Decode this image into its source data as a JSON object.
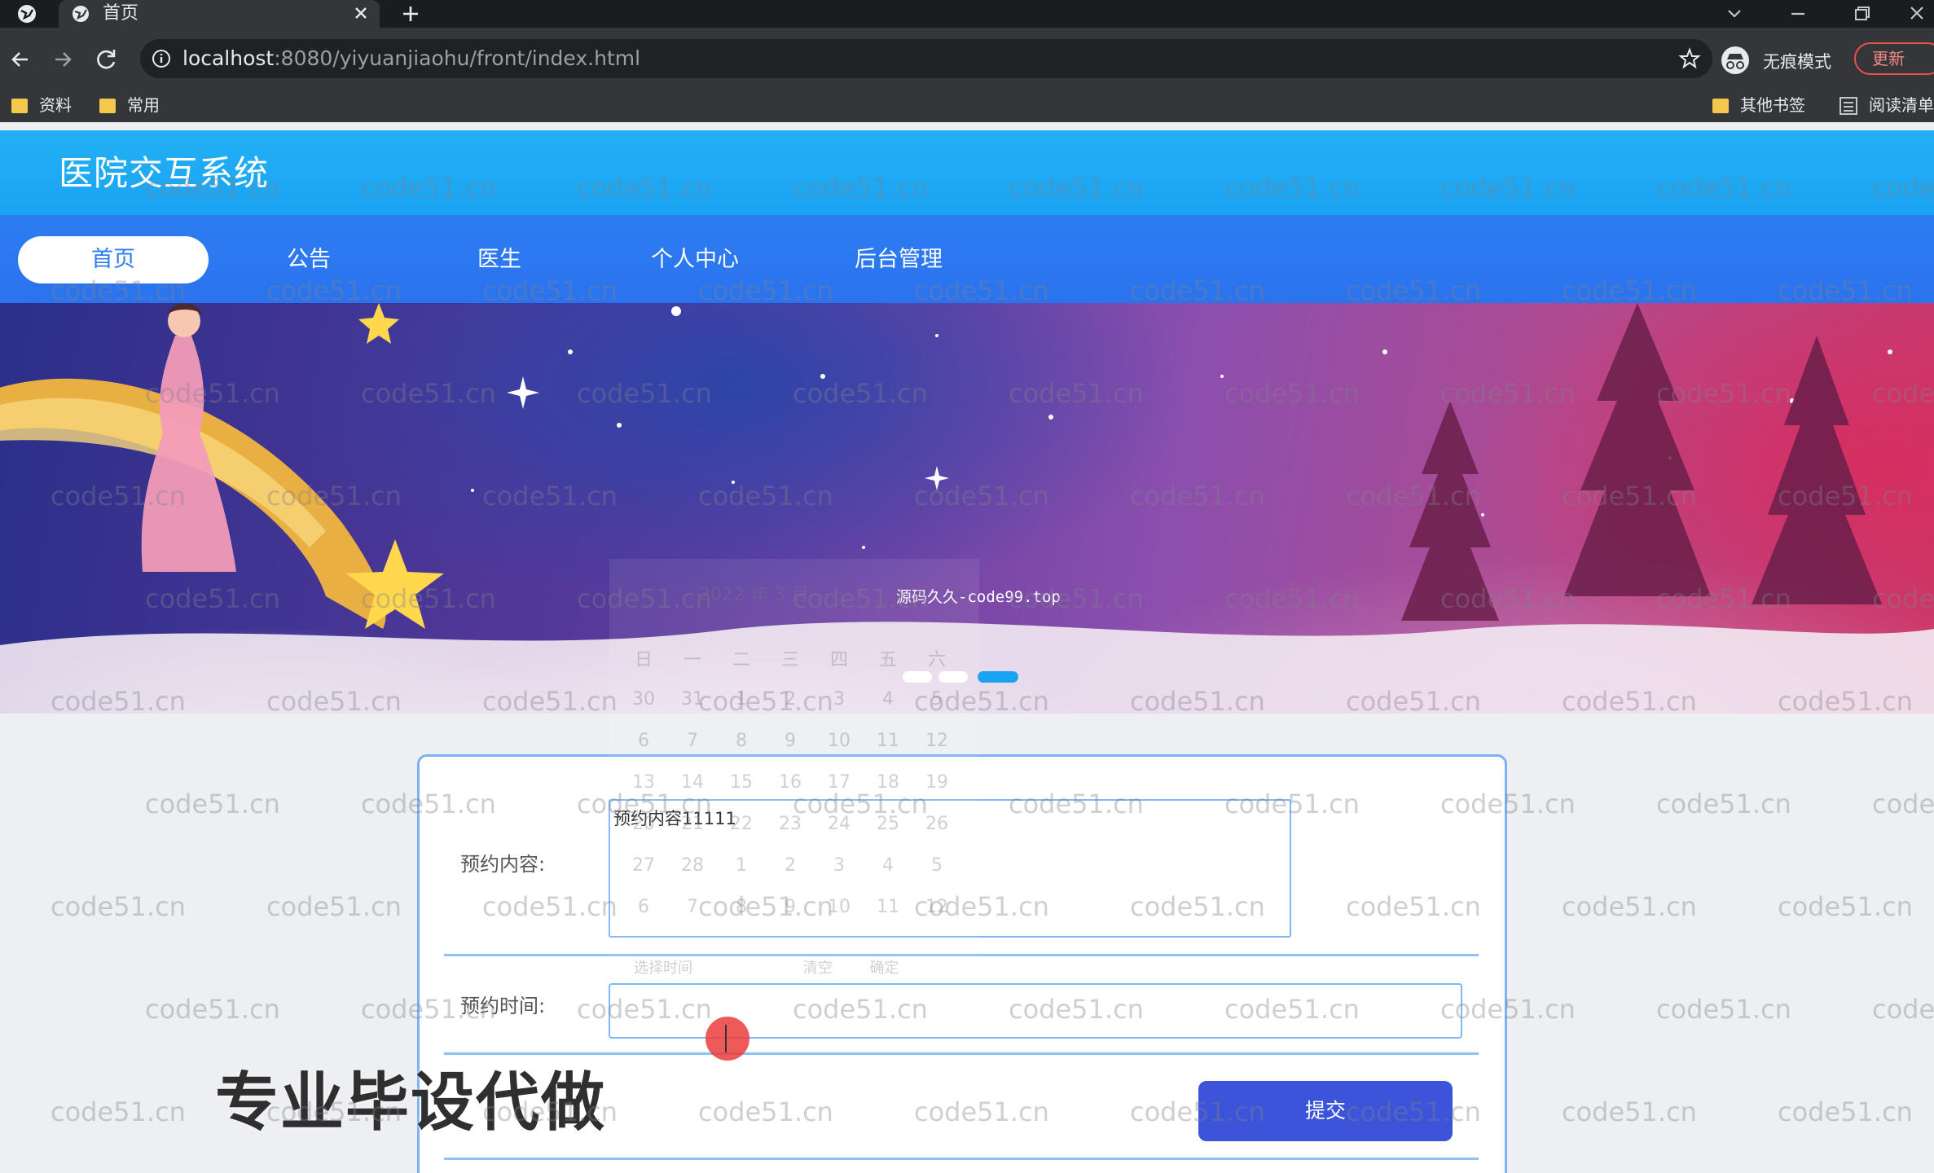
{
  "browser": {
    "tab_title": "首页",
    "url_host": "localhost",
    "url_path": ":8080/yiyuanjiaohu/front/index.html",
    "incognito_label": "无痕模式",
    "update_label": "更新",
    "bookmarks": [
      "资料",
      "常用"
    ],
    "other_bookmarks": "其他书签",
    "reading_list": "阅读清单"
  },
  "site": {
    "title": "医院交互系统",
    "nav": [
      "首页",
      "公告",
      "医生",
      "个人中心",
      "后台管理"
    ],
    "active_nav": "首页"
  },
  "banner": {
    "slides_total": 3,
    "active_slide": 3
  },
  "datepicker": {
    "header": "2022 年 3 月",
    "weekdays": [
      "日",
      "一",
      "二",
      "三",
      "四",
      "五",
      "六"
    ],
    "rows": [
      [
        "30",
        "31",
        "1",
        "2",
        "3",
        "4",
        "5"
      ],
      [
        "6",
        "7",
        "8",
        "9",
        "10",
        "11",
        "12"
      ],
      [
        "13",
        "14",
        "15",
        "16",
        "17",
        "18",
        "19"
      ],
      [
        "20",
        "21",
        "22",
        "23",
        "24",
        "25",
        "26"
      ],
      [
        "27",
        "28",
        "1",
        "2",
        "3",
        "4",
        "5"
      ],
      [
        "6",
        "7",
        "8",
        "9",
        "10",
        "11",
        "12"
      ]
    ],
    "footer_select_time": "选择时间",
    "footer_clear": "清空",
    "footer_confirm": "确定"
  },
  "form": {
    "content_label": "预约内容:",
    "content_value": "预约内容11111",
    "time_label": "预约时间:",
    "time_value": "",
    "submit_label": "提交"
  },
  "overlay": {
    "promo": "专业毕设代做",
    "source_note": "源码久久-code99.top",
    "watermark": "code51.cn"
  }
}
